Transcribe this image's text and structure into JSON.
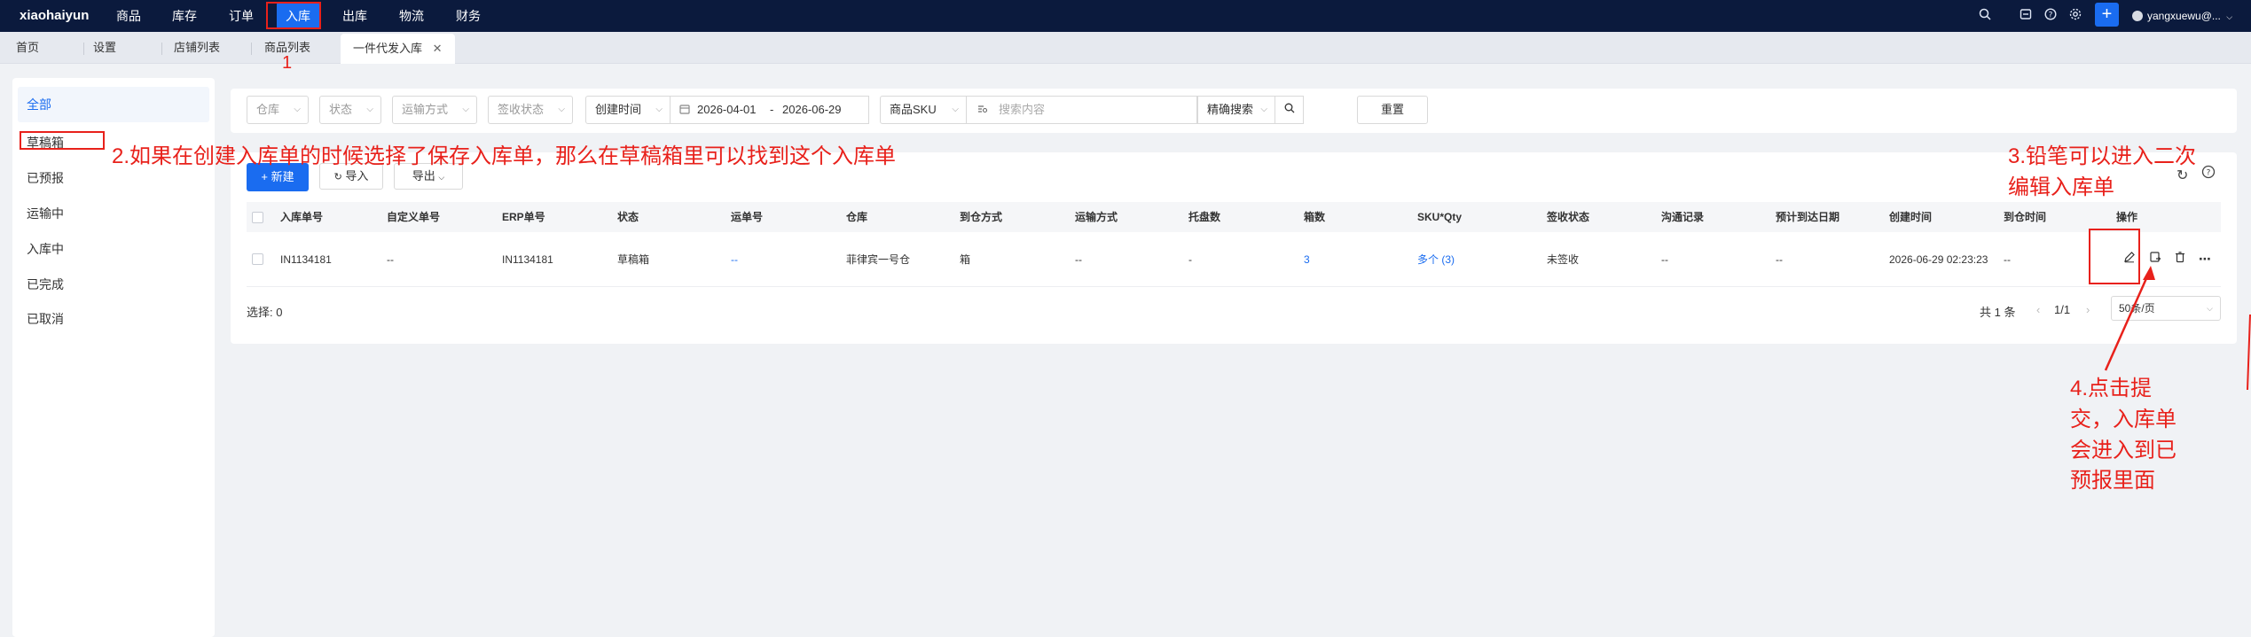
{
  "topnav": {
    "brand": "xiaohaiyun",
    "items": [
      "商品",
      "库存",
      "订单",
      "入库",
      "出库",
      "物流",
      "财务"
    ],
    "active_index": 3,
    "user": "yangxuewu@..."
  },
  "tabs": {
    "items": [
      "首页",
      "设置",
      "店铺列表",
      "商品列表",
      "一件代发入库"
    ],
    "active_index": 4
  },
  "sidebar": {
    "items": [
      "全部",
      "草稿箱",
      "已预报",
      "运输中",
      "入库中",
      "已完成",
      "已取消"
    ],
    "active_index": 0
  },
  "filters": {
    "warehouse": "仓库",
    "status": "状态",
    "transport": "运输方式",
    "sign_status": "签收状态",
    "time_type": "创建时间",
    "date_start": "2026-04-01",
    "date_sep": "-",
    "date_end": "2026-06-29",
    "sku_type": "商品SKU",
    "search_placeholder": "搜索内容",
    "match": "精确搜索",
    "reset": "重置"
  },
  "toolbar": {
    "new": "+ 新建",
    "import": "导入",
    "export": "导出"
  },
  "table": {
    "headers": [
      "入库单号",
      "自定义单号",
      "ERP单号",
      "状态",
      "运单号",
      "仓库",
      "到仓方式",
      "运输方式",
      "托盘数",
      "箱数",
      "SKU*Qty",
      "签收状态",
      "沟通记录",
      "预计到达日期",
      "创建时间",
      "到仓时间",
      "操作"
    ],
    "rows": [
      {
        "inbound_no": "IN1134181",
        "custom_no": "--",
        "erp_no": "IN1134181",
        "status": "草稿箱",
        "waybill": "--",
        "warehouse": "菲律宾一号仓",
        "arrival_mode": "箱",
        "transport": "--",
        "pallets": "-",
        "boxes": "3",
        "sku_qty": "多个 (3)",
        "sign_status": "未签收",
        "comm": "--",
        "eta": "--",
        "created": "2026-06-29 02:23:23",
        "arrived": "--"
      }
    ]
  },
  "footer": {
    "selected": "选择: 0",
    "total": "共 1 条",
    "page": "1/1",
    "page_size": "50条/页"
  },
  "annotations": {
    "step1": "1",
    "step2": "2.如果在创建入库单的时候选择了保存入库单，那么在草稿箱里可以找到这个入库单",
    "step3_line1": "3.铅笔可以进入二次",
    "step3_line2": "编辑入库单",
    "step4_line1": "4.点击提",
    "step4_line2": "交，入库单",
    "step4_line3": "会进入到已",
    "step4_line4": "预报里面",
    "color": "#e8211b"
  },
  "colors": {
    "nav_bg": "#0b1a3d",
    "accent": "#1a6cf0",
    "annotation": "#e8211b"
  }
}
